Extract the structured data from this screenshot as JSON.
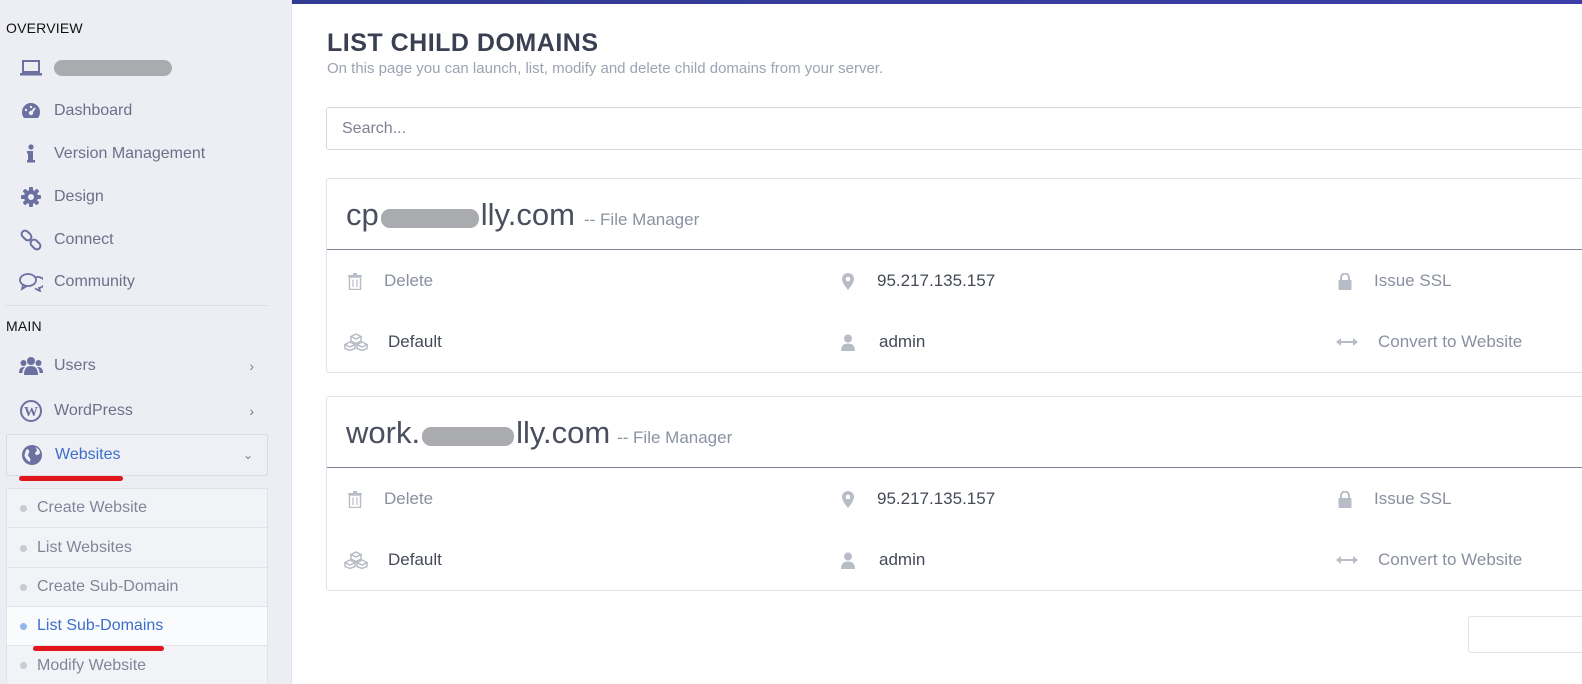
{
  "sidebar": {
    "overview_label": "OVERVIEW",
    "main_label": "MAIN",
    "overview_items": [
      {
        "label": "Dashboard",
        "icon": "dashboard-icon"
      },
      {
        "label": "Version Management",
        "icon": "info-icon"
      },
      {
        "label": "Design",
        "icon": "gear-icon"
      },
      {
        "label": "Connect",
        "icon": "link-icon"
      },
      {
        "label": "Community",
        "icon": "chat-icon"
      }
    ],
    "main_items": [
      {
        "label": "Users",
        "icon": "users-icon"
      },
      {
        "label": "WordPress",
        "icon": "wordpress-icon"
      },
      {
        "label": "Websites",
        "icon": "globe-icon"
      }
    ],
    "websites_submenu": [
      {
        "label": "Create Website"
      },
      {
        "label": "List Websites"
      },
      {
        "label": "Create Sub-Domain"
      },
      {
        "label": "List Sub-Domains"
      },
      {
        "label": "Modify Website"
      }
    ],
    "active_submenu": "List Sub-Domains"
  },
  "page": {
    "title": "LIST CHILD DOMAINS",
    "subtitle": "On this page you can launch, list, modify and delete child domains from your server.",
    "search_placeholder": "Search..."
  },
  "domains": [
    {
      "prefix": "cp",
      "suffix": "lly.com",
      "file_manager": "-- File Manager",
      "delete": "Delete",
      "ip": "95.217.135.157",
      "issue_ssl": "Issue SSL",
      "package": "Default",
      "owner": "admin",
      "convert": "Convert to Website"
    },
    {
      "prefix": "work.",
      "suffix": "lly.com",
      "file_manager": "-- File Manager",
      "delete": "Delete",
      "ip": "95.217.135.157",
      "issue_ssl": "Issue SSL",
      "package": "Default",
      "owner": "admin",
      "convert": "Convert to Website"
    }
  ],
  "colors": {
    "accent_blue": "#3c6ecc",
    "annotation_red": "#e0161b",
    "sidebar_bg": "#eceef4",
    "topbar": "#2f3a8c"
  }
}
